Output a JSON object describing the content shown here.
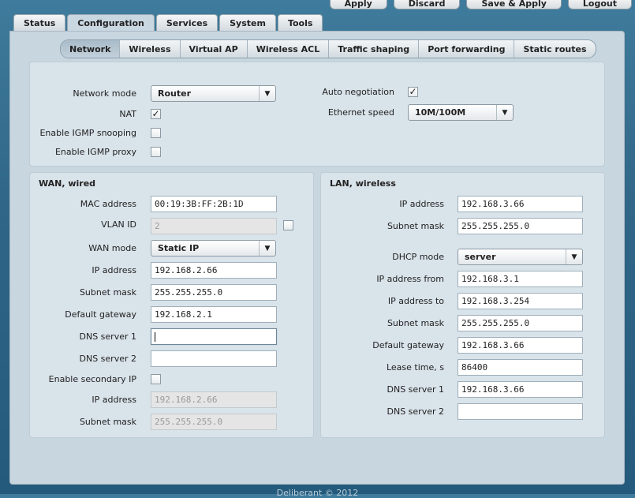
{
  "top_buttons": [
    "Apply",
    "Discard",
    "Save & Apply",
    "Logout"
  ],
  "main_tabs": [
    "Status",
    "Configuration",
    "Services",
    "System",
    "Tools"
  ],
  "main_tab_active": "Configuration",
  "sub_tabs": [
    "Network",
    "Wireless",
    "Virtual AP",
    "Wireless ACL",
    "Traffic shaping",
    "Port forwarding",
    "Static routes"
  ],
  "sub_tab_active": "Network",
  "general": {
    "network_mode_label": "Network mode",
    "network_mode_value": "Router",
    "nat_label": "NAT",
    "nat_checked": true,
    "igmp_snooping_label": "Enable IGMP snooping",
    "igmp_snooping_checked": false,
    "igmp_proxy_label": "Enable IGMP proxy",
    "igmp_proxy_checked": false,
    "auto_negotiation_label": "Auto negotiation",
    "auto_negotiation_checked": true,
    "ethernet_speed_label": "Ethernet speed",
    "ethernet_speed_value": "10M/100M"
  },
  "wan": {
    "title": "WAN, wired",
    "mac_label": "MAC address",
    "mac_value": "00:19:3B:FF:2B:1D",
    "vlan_label": "VLAN ID",
    "vlan_value": "2",
    "vlan_enabled": false,
    "mode_label": "WAN mode",
    "mode_value": "Static IP",
    "ip_label": "IP address",
    "ip_value": "192.168.2.66",
    "mask_label": "Subnet mask",
    "mask_value": "255.255.255.0",
    "gw_label": "Default gateway",
    "gw_value": "192.168.2.1",
    "dns1_label": "DNS server 1",
    "dns1_value": "",
    "dns2_label": "DNS server 2",
    "dns2_value": "",
    "secondary_label": "Enable secondary IP",
    "secondary_checked": false,
    "sec_ip_label": "IP address",
    "sec_ip_value": "192.168.2.66",
    "sec_mask_label": "Subnet mask",
    "sec_mask_value": "255.255.255.0"
  },
  "lan": {
    "title": "LAN, wireless",
    "ip_label": "IP address",
    "ip_value": "192.168.3.66",
    "mask_label": "Subnet mask",
    "mask_value": "255.255.255.0",
    "dhcp_label": "DHCP mode",
    "dhcp_value": "server",
    "from_label": "IP address from",
    "from_value": "192.168.3.1",
    "to_label": "IP address to",
    "to_value": "192.168.3.254",
    "dhcp_mask_label": "Subnet mask",
    "dhcp_mask_value": "255.255.255.0",
    "gw_label": "Default gateway",
    "gw_value": "192.168.3.66",
    "lease_label": "Lease time, s",
    "lease_value": "86400",
    "dns1_label": "DNS server 1",
    "dns1_value": "192.168.3.66",
    "dns2_label": "DNS server 2",
    "dns2_value": ""
  },
  "footer": "Deliberant © 2012"
}
